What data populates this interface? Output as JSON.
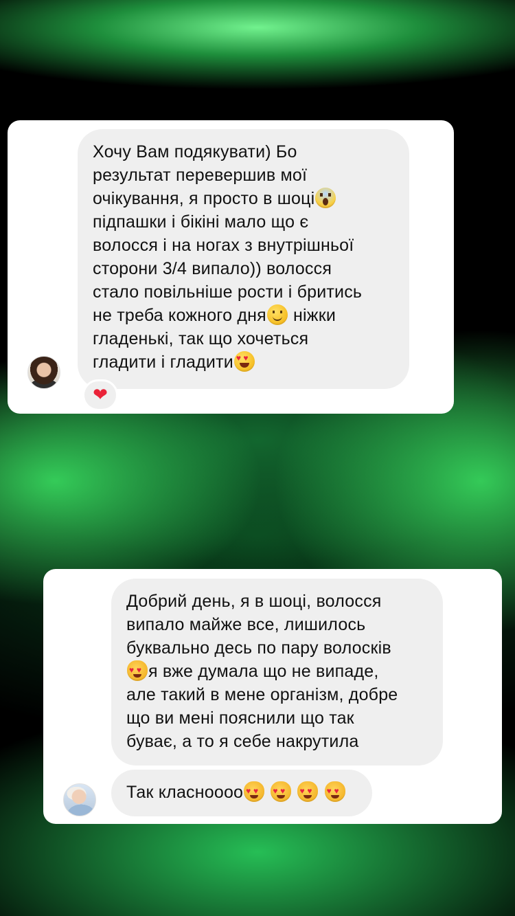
{
  "chat_1": {
    "message_lines": [
      "Хочу Вам подякувати) Бо",
      "результат перевершив мої",
      "очікування, я просто в шоці",
      "підпашки і бікіні мало що є",
      "волосся і на ногах з внутрішньої",
      "сторони 3/4 випало)) волосся",
      "стало повільніше рости і бритись",
      "не треба кожного дня",
      "ніжки",
      "гладенькі, так що хочеться",
      "гладити і гладити"
    ],
    "emojis": {
      "line_3": "😱",
      "line_8": "🙂",
      "line_11": "😍"
    },
    "reaction": "❤",
    "avatar": "user-avatar-woman"
  },
  "chat_2": {
    "message_lines": [
      "Добрий день, я в шоці, волосся",
      "випало майже все, лишилось",
      "буквально десь по пару волосків",
      "я вже думала що не випаде,",
      "але такий в мене організм, добре",
      "що ви мені пояснили що так",
      "буває, а то я себе накрутила"
    ],
    "emojis": {
      "line_4": "😻"
    },
    "reply": "Так класноооо",
    "reply_emojis": [
      "😻",
      "😻",
      "😻",
      "😻"
    ],
    "avatar": "user-avatar-girl"
  },
  "colors": {
    "bubble": "#efefef",
    "card": "#ffffff",
    "text": "#111111",
    "reaction_heart": "#ea2338",
    "background_glow": "#3ee070"
  }
}
